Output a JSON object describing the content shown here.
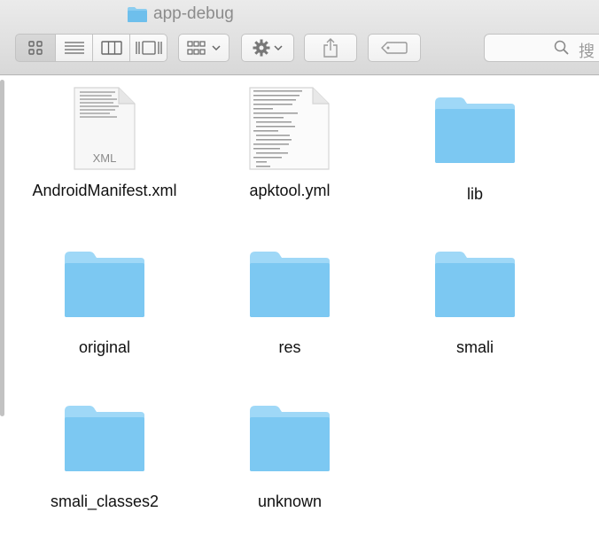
{
  "window": {
    "title": "app-debug"
  },
  "toolbar": {
    "view_modes": [
      "icon-view",
      "list-view",
      "column-view",
      "cover-flow-view"
    ],
    "active_view": "icon-view",
    "search_placeholder": "搜"
  },
  "items": [
    {
      "name": "AndroidManifest.xml",
      "kind": "xml-file",
      "badge": "XML"
    },
    {
      "name": "apktool.yml",
      "kind": "text-file"
    },
    {
      "name": "lib",
      "kind": "folder"
    },
    {
      "name": "original",
      "kind": "folder"
    },
    {
      "name": "res",
      "kind": "folder"
    },
    {
      "name": "smali",
      "kind": "folder"
    },
    {
      "name": "smali_classes2",
      "kind": "folder"
    },
    {
      "name": "unknown",
      "kind": "folder"
    }
  ],
  "colors": {
    "folder": "#7cc8f2",
    "folder_tab": "#9fd8f7"
  }
}
